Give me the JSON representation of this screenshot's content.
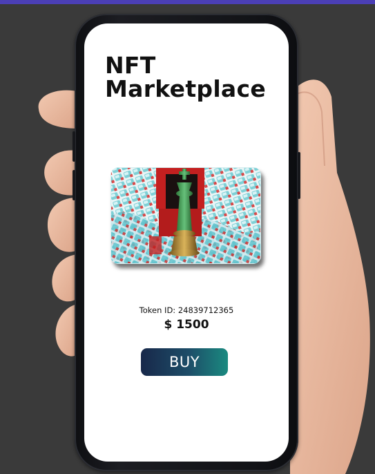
{
  "app": {
    "title_line1": "NFT",
    "title_line2": "Marketplace"
  },
  "nft": {
    "image_icon": "chess-king-artwork",
    "token_id_text": "Token ID: 24839712365",
    "price_text": "$ 1500",
    "buy_label": "BUY"
  },
  "colors": {
    "accent_strip": "#4b3fb6",
    "background": "#3a3a3a",
    "button_gradient_start": "#18284a",
    "button_gradient_end": "#1a8a80"
  }
}
